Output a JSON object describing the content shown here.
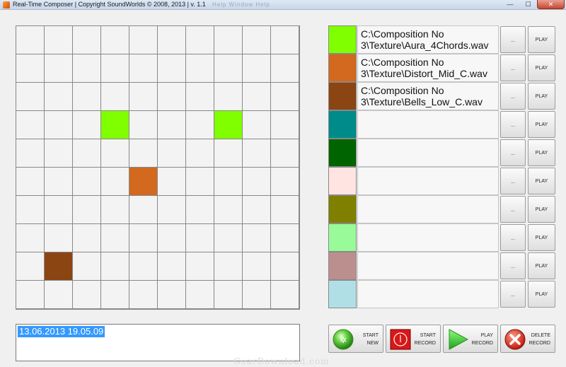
{
  "window": {
    "title": "Real-Time Composer | Copyright SoundWorlds © 2008, 2013 | v. 1.1",
    "menu_ghost": "Help   Window   Help",
    "minimize": "—",
    "maximize": "☐",
    "close": "✕"
  },
  "grid": {
    "rows": 10,
    "cols": 10,
    "filled": [
      {
        "row": 3,
        "col": 3,
        "color": "#7fff00"
      },
      {
        "row": 3,
        "col": 7,
        "color": "#7fff00"
      },
      {
        "row": 5,
        "col": 4,
        "color": "#d2691e"
      },
      {
        "row": 8,
        "col": 1,
        "color": "#8b4513"
      }
    ]
  },
  "samples": [
    {
      "color": "#7fff00",
      "path": "C:\\Composition No 3\\Texture\\Aura_4Chords.wav",
      "browse": "...",
      "play": "PLAY"
    },
    {
      "color": "#d2691e",
      "path": "C:\\Composition No 3\\Texture\\Distort_Mid_C.wav",
      "browse": "...",
      "play": "PLAY"
    },
    {
      "color": "#8b4513",
      "path": "C:\\Composition No 3\\Texture\\Bells_Low_C.wav",
      "browse": "...",
      "play": "PLAY"
    },
    {
      "color": "#008b8b",
      "path": "",
      "browse": "...",
      "play": "PLAY"
    },
    {
      "color": "#006400",
      "path": "",
      "browse": "...",
      "play": "PLAY"
    },
    {
      "color": "#ffe4e1",
      "path": "",
      "browse": "...",
      "play": "PLAY"
    },
    {
      "color": "#808000",
      "path": "",
      "browse": "...",
      "play": "PLAY"
    },
    {
      "color": "#98fb98",
      "path": "",
      "browse": "...",
      "play": "PLAY"
    },
    {
      "color": "#bc8f8f",
      "path": "",
      "browse": "...",
      "play": "PLAY"
    },
    {
      "color": "#b0e0e6",
      "path": "",
      "browse": "...",
      "play": "PLAY"
    }
  ],
  "status": {
    "value": "13.06.2013 19.05.09"
  },
  "transport": {
    "start_new": {
      "line1": "START",
      "line2": "NEW",
      "icon": "green-orb-icon"
    },
    "start_record": {
      "line1": "START",
      "line2": "RECORD",
      "icon": "red-record-icon"
    },
    "play_record": {
      "line1": "PLAY",
      "line2": "RECORD",
      "icon": "green-play-icon"
    },
    "delete_record": {
      "line1": "DELETE",
      "line2": "RECORD",
      "icon": "red-x-icon"
    }
  },
  "watermark": "GearDownload.com"
}
